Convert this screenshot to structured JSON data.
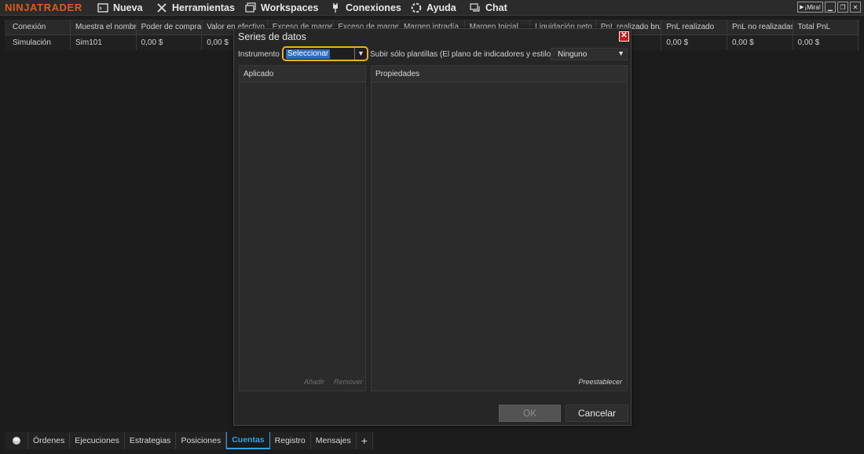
{
  "app": {
    "logo": "NINJATRADER",
    "menu": [
      {
        "label": "Nueva",
        "icon": "window-icon"
      },
      {
        "label": "Herramientas",
        "icon": "tools-icon"
      },
      {
        "label": "Workspaces",
        "icon": "workspaces-icon"
      },
      {
        "label": "Conexiones",
        "icon": "plug-icon"
      },
      {
        "label": "Ayuda",
        "icon": "lifebuoy-icon"
      },
      {
        "label": "Chat",
        "icon": "chat-icon"
      }
    ],
    "window_buttons": {
      "watch": "¡Mira!",
      "minimize": "",
      "restore": "",
      "close": ""
    }
  },
  "grid": {
    "headers": [
      "Conexión",
      "Muestra el nombr",
      "Poder de compra",
      "Valor en efectivo",
      "Exceso de marge",
      "Exceso de marge",
      "Margen intradía",
      "Margen Inicial",
      "Liquidación neto",
      "PnL realizado bru",
      "PnL realizado",
      "PnL no realizadas",
      "Total PnL"
    ],
    "rows": [
      [
        "Simulación",
        "Sim101",
        "0,00 $",
        "0,00 $",
        "",
        "",
        "",
        "",
        "",
        "",
        "0,00 $",
        "0,00 $",
        "0,00 $"
      ]
    ]
  },
  "dialog": {
    "title": "Series de datos",
    "close": "✕",
    "instrument_label": "Instrumento",
    "instrument_value": "Seleccionar",
    "template_label": "Subir sólo plantillas (El plano de indicadores y estilo)",
    "template_value": "Ninguno",
    "applied_header": "Aplicado",
    "properties_header": "Propiedades",
    "add": "Añadir",
    "remove": "Remover",
    "preset": "Preestablecer",
    "ok": "OK",
    "cancel": "Cancelar"
  },
  "tabs": {
    "items": [
      "Órdenes",
      "Ejecuciones",
      "Estrategias",
      "Posiciones",
      "Cuentas",
      "Registro",
      "Mensajes"
    ],
    "active": "Cuentas",
    "add": "+"
  },
  "colors": {
    "brand": "#e35a17",
    "focus": "#f0b020",
    "active_tab": "#2da3ee",
    "close": "#d01515"
  }
}
